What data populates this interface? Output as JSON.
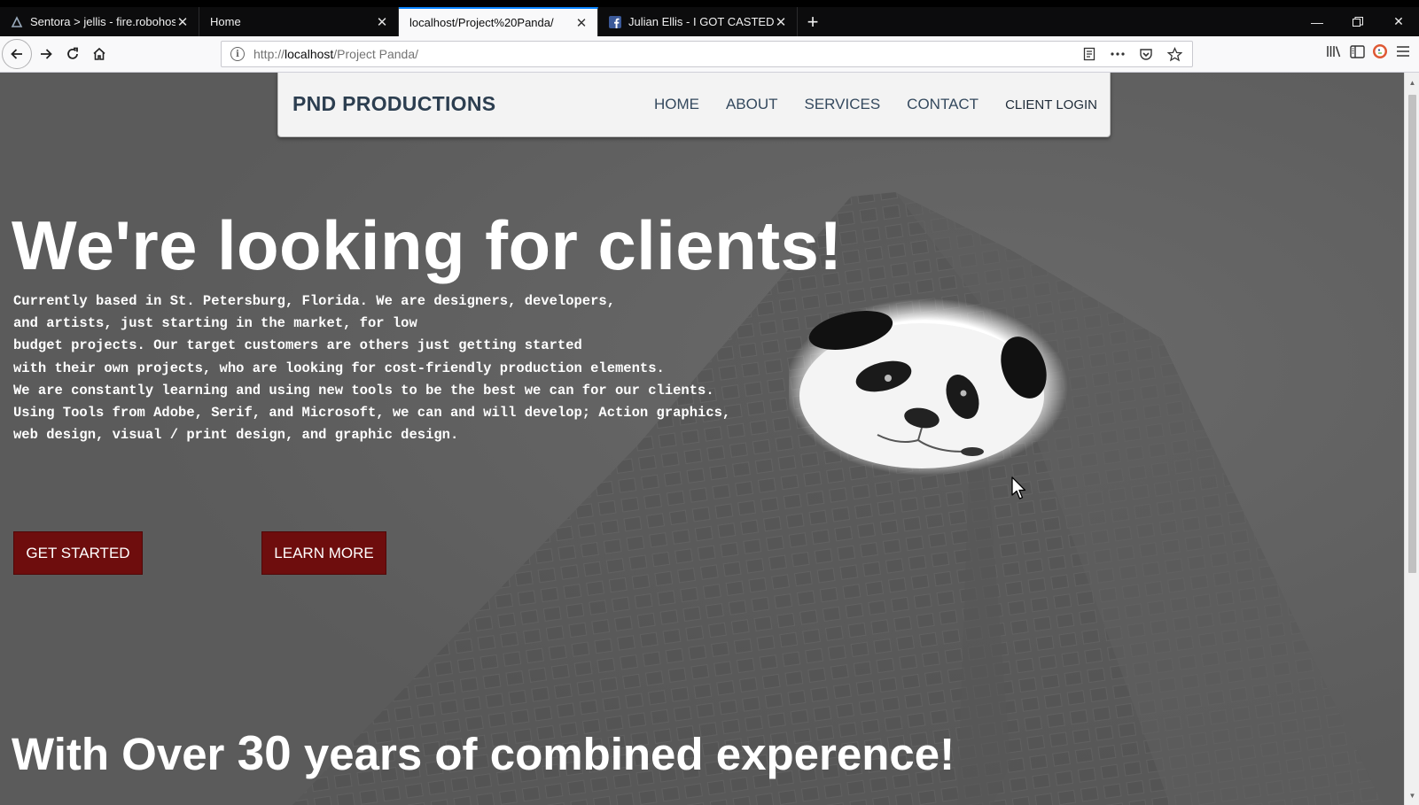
{
  "browser": {
    "tabs": [
      {
        "title": "Sentora > jellis - fire.robohost.t",
        "active": false,
        "favicon": "sentora-icon"
      },
      {
        "title": "Home",
        "active": false,
        "favicon": "none"
      },
      {
        "title": "localhost/Project%20Panda/",
        "active": true,
        "favicon": "none"
      },
      {
        "title": "Julian Ellis - I GOT CASTED!!!!",
        "active": false,
        "favicon": "facebook-icon"
      }
    ],
    "url": {
      "prefix": "http://",
      "host": "localhost",
      "path": "/Project Panda/"
    }
  },
  "site": {
    "brand": "PND PRODUCTIONS",
    "menu": [
      "HOME",
      "ABOUT",
      "SERVICES",
      "CONTACT",
      "CLIENT LOGIN"
    ],
    "headline": "We're looking for clients!",
    "intro_lines": [
      "Currently based in St. Petersburg, Florida. We are designers, developers,",
      "and artists, just starting in the market, for low",
      "budget projects. Our target customers are others just getting started",
      "with their own projects, who are looking for cost-friendly production elements.",
      "We are constantly learning and using new tools to be the best we can for our clients.",
      "Using Tools from Adobe, Serif, and Microsoft, we can and will develop; Action graphics,",
      "web design, visual / print design, and graphic design."
    ],
    "buttons": {
      "get_started": "GET STARTED",
      "learn_more": "LEARN MORE"
    },
    "subheadline": {
      "before": "With Over ",
      "number": "30",
      "after": " years of combined experence!"
    }
  },
  "colors": {
    "cta": "#6e0d0d",
    "page_bg": "#5d5d5d",
    "brand_text": "#2c3e50",
    "tab_active_accent": "#0a84ff"
  }
}
